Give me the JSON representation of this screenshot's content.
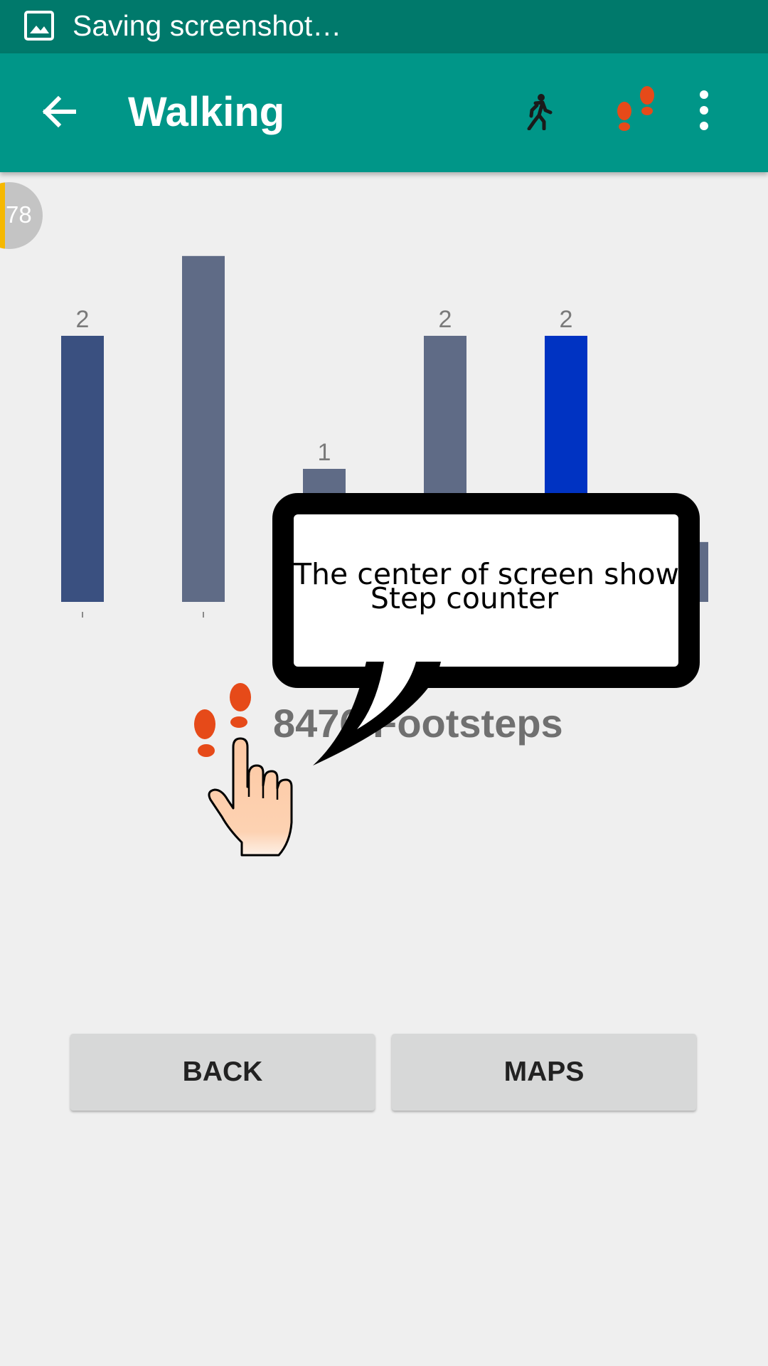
{
  "status_bar": {
    "text": "Saving screenshot…",
    "icon": "image-icon"
  },
  "app_bar": {
    "title": "Walking",
    "actions": [
      "back-arrow-icon",
      "walking-icon",
      "footsteps-icon",
      "more-vert-icon"
    ]
  },
  "badge": {
    "text": "78"
  },
  "chart_data": {
    "type": "bar",
    "values": [
      2,
      2.6,
      1,
      2,
      2,
      0.45
    ],
    "labels": [
      "2",
      "",
      "1",
      "2",
      "2",
      ""
    ],
    "colors": [
      "#3a5080",
      "#5f6b86",
      "#5f6b86",
      "#5f6b86",
      "#0033c2",
      "#5f6b86"
    ],
    "grid": false
  },
  "tooltip": {
    "line1": "The center of screen shows",
    "line2": "Step counter"
  },
  "footsteps": {
    "label": "8476 Footsteps",
    "icon_color": "#e64a19"
  },
  "buttons": {
    "back": "BACK",
    "maps": "MAPS"
  },
  "colors": {
    "status_bar": "#00796b",
    "app_bar": "#009688",
    "background": "#efefef",
    "accent": "#e64a19"
  }
}
